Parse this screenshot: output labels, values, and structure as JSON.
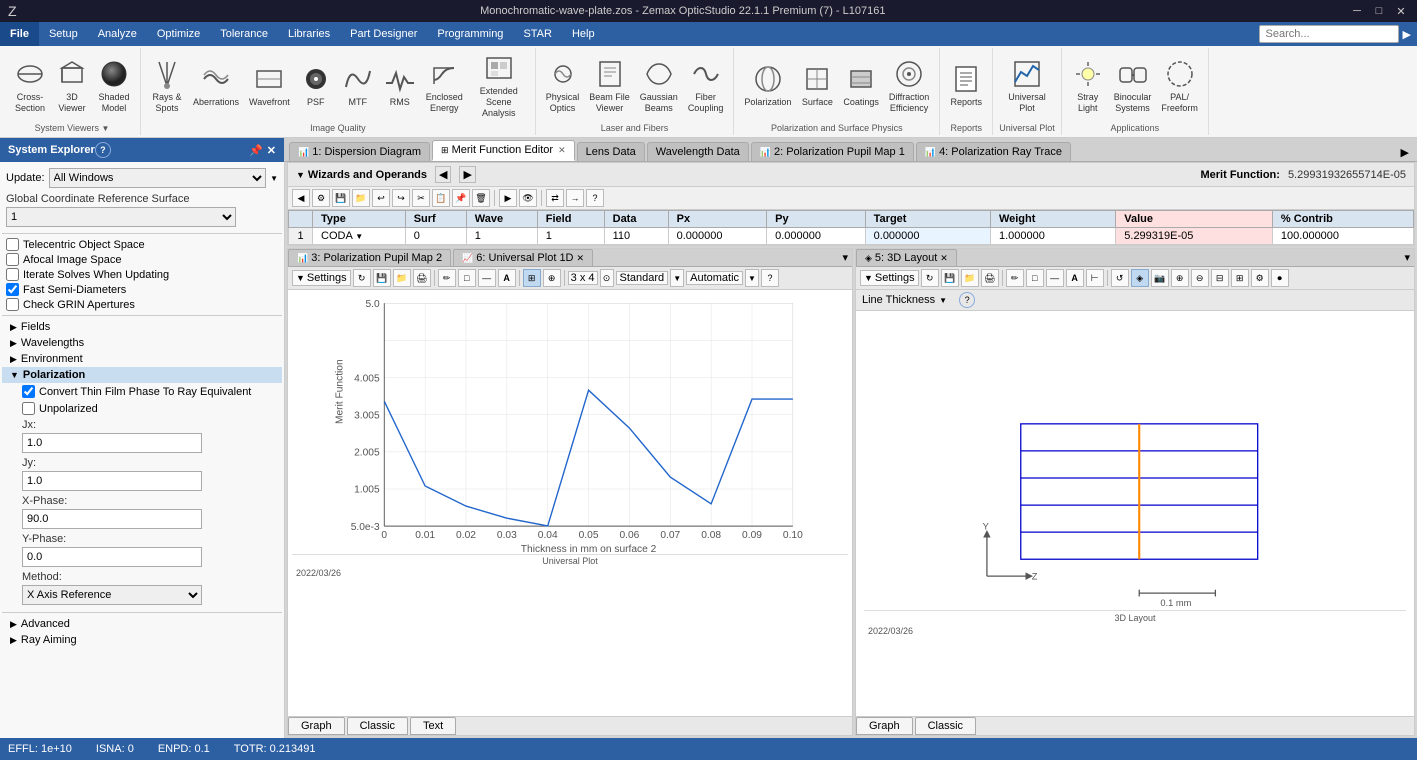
{
  "titleBar": {
    "title": "Monochromatic-wave-plate.zos - Zemax OpticStudio 22.1.1  Premium (7) - L107161",
    "minimize": "─",
    "maximize": "□",
    "close": "✕"
  },
  "menuBar": {
    "items": [
      "File",
      "Setup",
      "Analyze",
      "Optimize",
      "Tolerance",
      "Libraries",
      "Part Designer",
      "Programming",
      "STAR",
      "Help"
    ]
  },
  "toolbar": {
    "search_placeholder": "Search...",
    "groups": [
      {
        "label": "System Viewers",
        "buttons": [
          {
            "id": "cross-section",
            "label": "Cross-Section",
            "icon": "⊕"
          },
          {
            "id": "3d-viewer",
            "label": "3D Viewer",
            "icon": "◈"
          },
          {
            "id": "shaded-model",
            "label": "Shaded Model",
            "icon": "◉"
          }
        ]
      },
      {
        "label": "Image Quality",
        "buttons": [
          {
            "id": "rays-spots",
            "label": "Rays & Spots",
            "icon": "✦"
          },
          {
            "id": "aberrations",
            "label": "Aberrations",
            "icon": "≋"
          },
          {
            "id": "wavefront",
            "label": "Wavefront",
            "icon": "⌇"
          },
          {
            "id": "psf",
            "label": "PSF",
            "icon": "⬤"
          },
          {
            "id": "mtf",
            "label": "MTF",
            "icon": "〜"
          },
          {
            "id": "rms",
            "label": "RMS",
            "icon": "∿"
          },
          {
            "id": "enclosed-energy",
            "label": "Enclosed Energy",
            "icon": "⌬"
          },
          {
            "id": "extended-scene",
            "label": "Extended Scene Analysis",
            "icon": "▦"
          }
        ]
      },
      {
        "label": "Laser and Fibers",
        "buttons": [
          {
            "id": "physical-optics",
            "label": "Physical Optics",
            "icon": "❋"
          },
          {
            "id": "beam-file-viewer",
            "label": "Beam File Viewer",
            "icon": "▤"
          },
          {
            "id": "gaussian-beams",
            "label": "Gaussian Beams",
            "icon": "⌇"
          },
          {
            "id": "fiber-coupling",
            "label": "Fiber Coupling",
            "icon": "⊃"
          }
        ]
      },
      {
        "label": "Polarization and Surface Physics",
        "buttons": [
          {
            "id": "polarization",
            "label": "Polarization",
            "icon": "⊕"
          },
          {
            "id": "surface",
            "label": "Surface",
            "icon": "◫"
          },
          {
            "id": "coatings",
            "label": "Coatings",
            "icon": "◰"
          },
          {
            "id": "diffraction-efficiency",
            "label": "Diffraction Efficiency",
            "icon": "⊚"
          }
        ]
      },
      {
        "label": "Reports",
        "buttons": [
          {
            "id": "reports",
            "label": "Reports",
            "icon": "≡"
          }
        ]
      },
      {
        "label": "Universal Plot",
        "buttons": [
          {
            "id": "universal-plot",
            "label": "Universal Plot",
            "icon": "📈"
          }
        ]
      },
      {
        "label": "Applications",
        "buttons": [
          {
            "id": "stray-light",
            "label": "Stray Light",
            "icon": "✧"
          },
          {
            "id": "binocular-systems",
            "label": "Binocular Systems",
            "icon": "⊞"
          },
          {
            "id": "pal-freeform",
            "label": "PAL/Freeform",
            "icon": "◌"
          }
        ]
      }
    ]
  },
  "sidebar": {
    "title": "System Explorer",
    "helpIcon": "?",
    "updateLabel": "Update:",
    "updateValue": "All Windows",
    "globalCoordRef": "Global Coordinate Reference Surface",
    "globalCoordValue": "1",
    "checkboxes": [
      {
        "id": "telecentric",
        "label": "Telecentric Object Space",
        "checked": false
      },
      {
        "id": "afocal",
        "label": "Afocal Image Space",
        "checked": false
      },
      {
        "id": "iterate-solves",
        "label": "Iterate Solves When Updating",
        "checked": false
      },
      {
        "id": "fast-semi",
        "label": "Fast Semi-Diameters",
        "checked": true
      },
      {
        "id": "check-grin",
        "label": "Check GRIN Apertures",
        "checked": false
      }
    ],
    "treeItems": [
      {
        "id": "fields",
        "label": "Fields",
        "expanded": false
      },
      {
        "id": "wavelengths",
        "label": "Wavelengths",
        "expanded": false
      },
      {
        "id": "environment",
        "label": "Environment",
        "expanded": false
      },
      {
        "id": "polarization",
        "label": "Polarization",
        "expanded": true,
        "selected": true
      }
    ],
    "polarization": {
      "checkbox1Label": "Convert Thin Film Phase To Ray Equivalent",
      "checkbox1Checked": true,
      "checkbox2Label": "Unpolarized",
      "checkbox2Checked": false,
      "jxLabel": "Jx:",
      "jxValue": "1.0",
      "jyLabel": "Jy:",
      "jyValue": "1.0",
      "xPhaseLabel": "X-Phase:",
      "xPhaseValue": "90.0",
      "yPhaseLabel": "Y-Phase:",
      "yPhaseValue": "0.0",
      "methodLabel": "Method:",
      "methodValue": "X Axis Reference"
    },
    "advanced": "Advanced",
    "rayAiming": "Ray Aiming"
  },
  "tabs": [
    {
      "id": "dispersion",
      "label": "1: Dispersion Diagram",
      "active": false,
      "closeable": false,
      "icon": "📊"
    },
    {
      "id": "merit-function",
      "label": "Merit Function Editor",
      "active": true,
      "closeable": true,
      "icon": "⊞"
    },
    {
      "id": "lens-data",
      "label": "Lens Data",
      "active": false,
      "closeable": false
    },
    {
      "id": "wavelength-data",
      "label": "Wavelength Data",
      "active": false,
      "closeable": false
    },
    {
      "id": "polarization-pupil-2",
      "label": "2: Polarization Pupil Map 1",
      "active": false,
      "closeable": false,
      "icon": "📊"
    },
    {
      "id": "polarization-ray-trace",
      "label": "4: Polarization Ray Trace",
      "active": false,
      "closeable": false,
      "icon": "📊"
    }
  ],
  "meritFunction": {
    "label": "Merit Function:",
    "value": "5.29931932655714E-05",
    "wizardsLabel": "Wizards and Operands",
    "tableHeaders": [
      "Type",
      "Surf",
      "Wave",
      "Field",
      "Data",
      "Px",
      "Py",
      "Target",
      "Weight",
      "Value",
      "% Contrib"
    ],
    "rows": [
      {
        "num": "1",
        "type": "CODA",
        "surf": "0",
        "wave": "1",
        "field": "1",
        "data": "110",
        "px": "0.000000",
        "py": "0.000000",
        "target": "0.000000",
        "weight": "1.000000",
        "value": "5.299319E-05",
        "contrib": "100.000000"
      }
    ]
  },
  "bottomTabs": {
    "left": {
      "tabs": [
        {
          "id": "pol-pupil-3",
          "label": "3: Polarization Pupil Map 2",
          "active": true,
          "closeable": false,
          "icon": "📊"
        },
        {
          "id": "universal-1d",
          "label": "6: Universal Plot 1D",
          "active": false,
          "closeable": true,
          "icon": "📈"
        }
      ]
    },
    "right": {
      "tabs": [
        {
          "id": "layout-3d",
          "label": "5: 3D Layout",
          "active": true,
          "closeable": true,
          "icon": "◈"
        }
      ]
    }
  },
  "universalPlot": {
    "title": "Universal Plot",
    "dateLabel": "2022/03/26",
    "xLabel": "Thickness in mm on surface 2",
    "yLabel": "Merit Function",
    "graphTabs": [
      "Graph",
      "Classic",
      "Text"
    ],
    "settings": "Settings",
    "gridLabel": "3 x 4",
    "standardLabel": "Standard",
    "automaticLabel": "Automatic",
    "chartData": {
      "xMin": 0,
      "xMax": 0.1,
      "yMin": 0,
      "yMax": 5.0,
      "points": [
        [
          0,
          2.8
        ],
        [
          0.01,
          0.9
        ],
        [
          0.02,
          0.45
        ],
        [
          0.03,
          0.18
        ],
        [
          0.04,
          0.005
        ],
        [
          0.05,
          3.05
        ],
        [
          0.06,
          2.2
        ],
        [
          0.07,
          1.1
        ],
        [
          0.08,
          0.5
        ],
        [
          0.09,
          2.85
        ],
        [
          0.1,
          2.85
        ]
      ],
      "yAxisLabels": [
        "5.0e-3",
        "1.005",
        "2.005",
        "3.005",
        "4.005",
        "5.0"
      ],
      "xAxisLabels": [
        "0",
        "0.01",
        "0.02",
        "0.03",
        "0.04",
        "0.05",
        "0.06",
        "0.07",
        "0.08",
        "0.09",
        "0.10"
      ]
    }
  },
  "layout3d": {
    "title": "5: 3D Layout",
    "dateLabel": "2022/03/26",
    "scaleLabel": "0.1 mm",
    "lineThicknessLabel": "Line Thickness",
    "footerLabel": "3D Layout",
    "graphTabs": [
      "Graph",
      "Classic"
    ],
    "settings": "Settings"
  },
  "statusBar": {
    "effl": "EFFL: 1e+10",
    "isna": "ISNA: 0",
    "enpd": "ENPD: 0.1",
    "totr": "TOTR: 0.213491"
  }
}
